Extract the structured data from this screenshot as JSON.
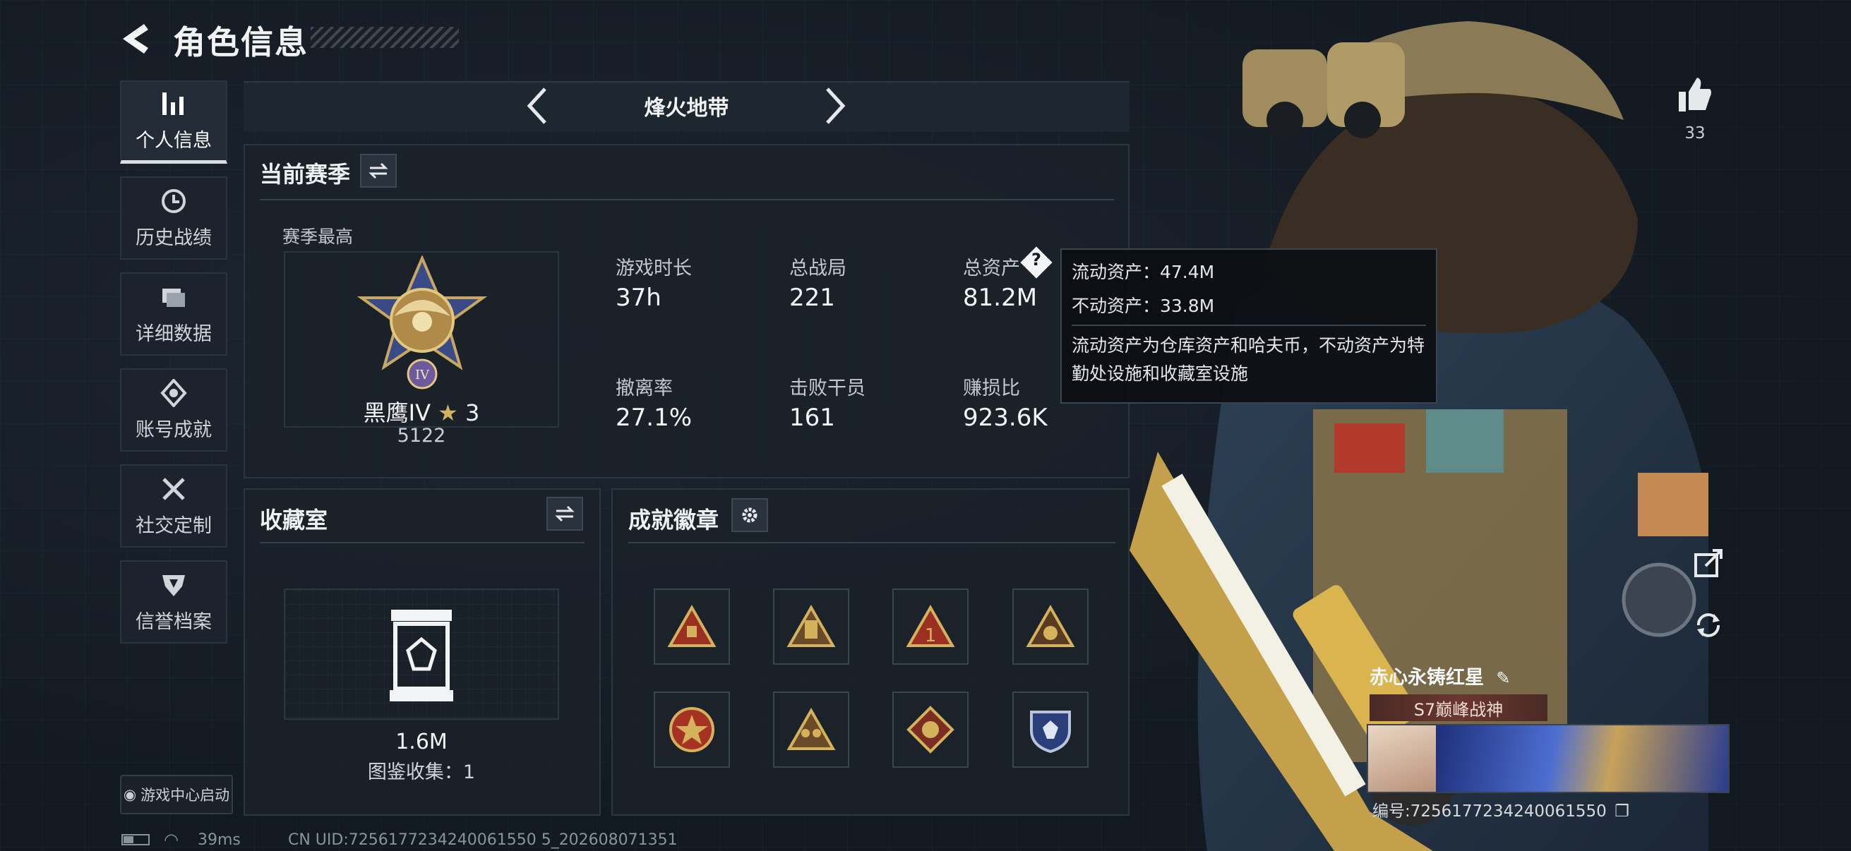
{
  "header": {
    "title": "角色信息"
  },
  "sidebar": {
    "items": [
      {
        "label": "个人信息",
        "icon": "bar-chart-icon",
        "active": true
      },
      {
        "label": "历史战绩",
        "icon": "clock-icon"
      },
      {
        "label": "详细数据",
        "icon": "folder-icon"
      },
      {
        "label": "账号成就",
        "icon": "medal-icon"
      },
      {
        "label": "社交定制",
        "icon": "tools-icon"
      },
      {
        "label": "信誉档案",
        "icon": "shield-icon"
      }
    ],
    "launcher_label": "游戏中心启动"
  },
  "mode_tabs": {
    "current": "烽火地带"
  },
  "season_panel": {
    "title": "当前赛季",
    "best_label": "赛季最高",
    "rank_name": "黑鹰IV",
    "rank_stars": "3",
    "rank_score": "5122",
    "stats": [
      {
        "label": "游戏时长",
        "value": "37h"
      },
      {
        "label": "总战局",
        "value": "221"
      },
      {
        "label": "总资产",
        "value": "81.2M"
      },
      {
        "label": "撤离率",
        "value": "27.1%"
      },
      {
        "label": "击败干员",
        "value": "161"
      },
      {
        "label": "赚损比",
        "value": "923.6K"
      }
    ]
  },
  "tooltip": {
    "line1": "流动资产：47.4M",
    "line2": "不动资产：33.8M",
    "description": "流动资产为仓库资产和哈夫币，不动资产为特勤处设施和收藏室设施"
  },
  "collection_panel": {
    "title": "收藏室",
    "value": "1.6M",
    "catalog": "图鉴收集：1"
  },
  "badges_panel": {
    "title": "成就徽章",
    "badges": [
      "badge-1",
      "badge-2",
      "badge-3",
      "badge-4",
      "badge-5",
      "badge-6",
      "badge-7",
      "badge-8"
    ]
  },
  "likes": {
    "count": "33"
  },
  "player": {
    "name": "赤心永铸红星",
    "title": "S7巅峰战神",
    "uid": "编号:7256177234240061550",
    "bottom_uid": "CN UID:7256177234240061550 5_202608071351"
  },
  "status": {
    "ping": "39ms"
  },
  "colors": {
    "accent": "#d4b25c",
    "bg": "#141a22"
  }
}
